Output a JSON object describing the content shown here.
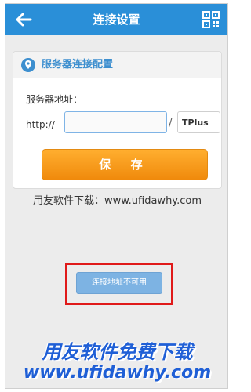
{
  "header": {
    "title": "连接设置",
    "back_icon": "back-arrow-icon",
    "qr_icon": "qr-code-icon",
    "color": "#2a8fd8"
  },
  "card": {
    "icon": "location-pin-icon",
    "title": "服务器连接配置",
    "address_label": "服务器地址：",
    "protocol": "http://",
    "address_value": "",
    "separator": "/",
    "path_value": "TPlus"
  },
  "save_button": {
    "label": "保 存",
    "color": "#f59a1c"
  },
  "watermark_line": "用友软件下载：www.ufidawhy.com",
  "status_button": {
    "label": "连接地址不可用",
    "highlight_color": "#e01a1a"
  },
  "bottom_watermark": {
    "line1": "用友软件免费下载",
    "line2": "www.ufidawhy.com"
  }
}
